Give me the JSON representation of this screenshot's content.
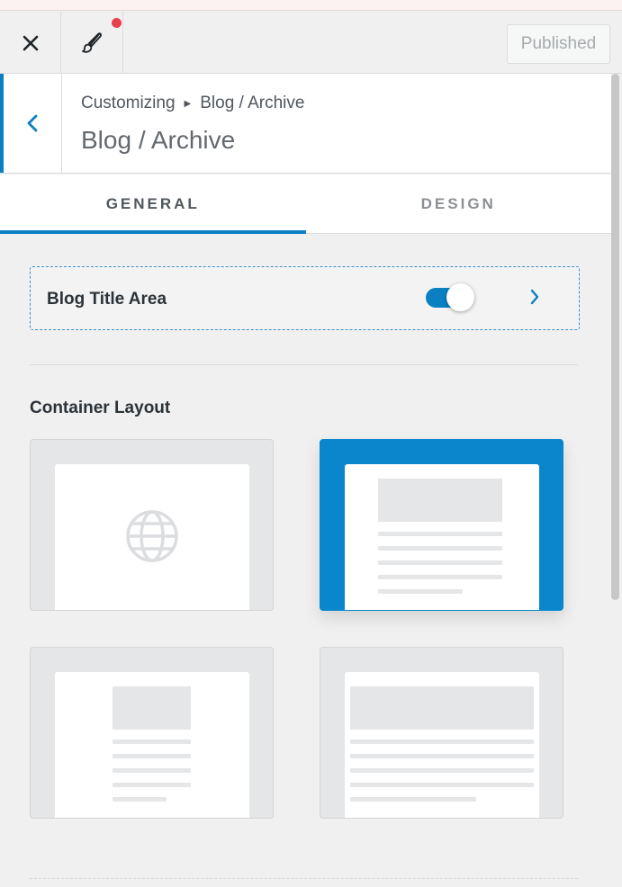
{
  "toolbar": {
    "close_icon": "close-icon",
    "style_icon": "brush-icon",
    "publish_label": "Published"
  },
  "header": {
    "breadcrumb_root": "Customizing",
    "breadcrumb_current": "Blog / Archive",
    "title": "Blog / Archive"
  },
  "tabs": [
    {
      "label": "GENERAL",
      "active": true
    },
    {
      "label": "DESIGN",
      "active": false
    }
  ],
  "blog_title_area": {
    "label": "Blog Title Area",
    "enabled": true
  },
  "container_layout": {
    "title": "Container Layout",
    "options": [
      "full-width",
      "boxed",
      "content-boxed",
      "full-width-contained"
    ],
    "selected": "boxed"
  },
  "colors": {
    "accent": "#0a7fc2",
    "selected_option": "#0a87cc",
    "notification_dot": "#e8424a"
  }
}
